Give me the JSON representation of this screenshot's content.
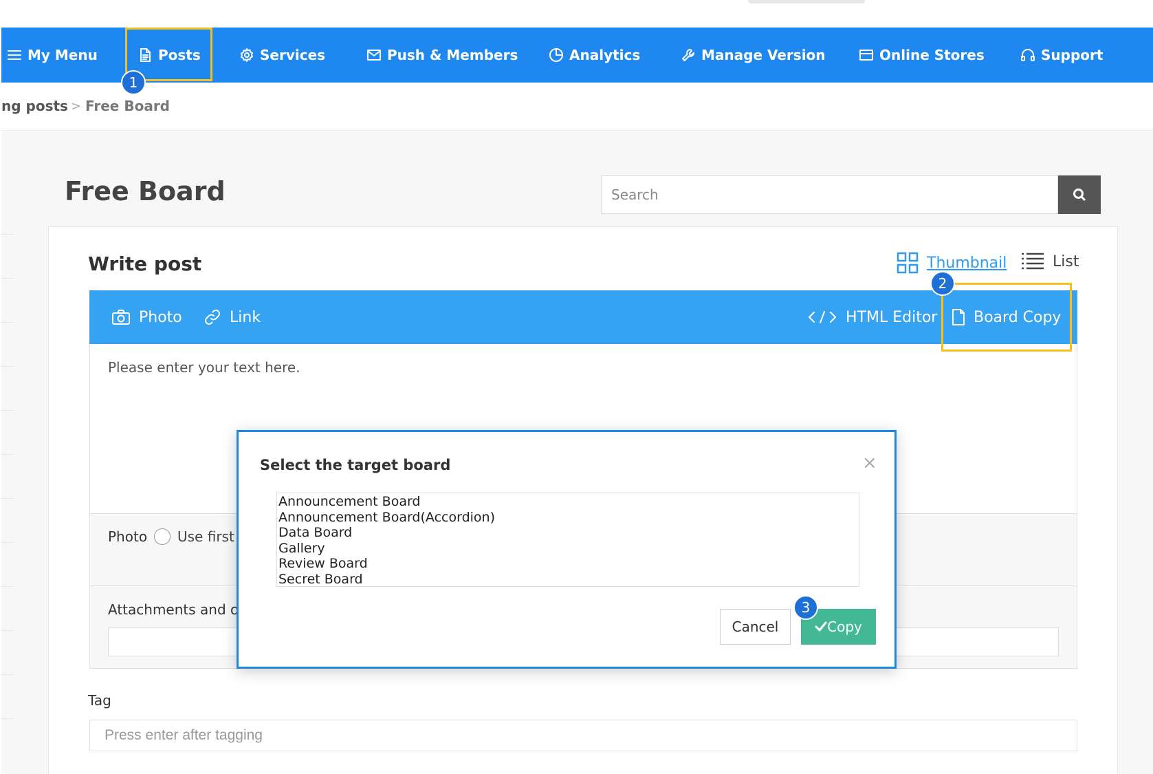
{
  "colors": {
    "nav_bg": "#1e88f0",
    "toolbar_bg": "#36a2f2",
    "highlight": "#f5bf20",
    "step_badge": "#1e6fd6",
    "copy_button": "#42b895",
    "thumbnail_active": "#2f9af0"
  },
  "nav": {
    "items": [
      {
        "label": "My Menu",
        "icon": "menu-icon"
      },
      {
        "label": "Posts",
        "icon": "document-icon"
      },
      {
        "label": "Services",
        "icon": "gear-icon"
      },
      {
        "label": "Push & Members",
        "icon": "mail-icon"
      },
      {
        "label": "Analytics",
        "icon": "pie-chart-icon"
      },
      {
        "label": "Manage Version",
        "icon": "wrench-icon"
      },
      {
        "label": "Online Stores",
        "icon": "card-icon"
      },
      {
        "label": "Support",
        "icon": "headset-icon"
      }
    ]
  },
  "steps": [
    "1",
    "2",
    "3"
  ],
  "breadcrumb": {
    "parent": "ng posts",
    "separator": ">",
    "current": "Free Board"
  },
  "page": {
    "title": "Free Board",
    "search_placeholder": "Search"
  },
  "card": {
    "title": "Write post",
    "view_toggle": {
      "thumbnail": "Thumbnail",
      "list": "List"
    }
  },
  "toolbar": {
    "photo": "Photo",
    "link": "Link",
    "html_editor": "HTML Editor",
    "board_copy": "Board Copy"
  },
  "editor": {
    "placeholder": "Please enter your text here."
  },
  "photo_row": {
    "label": "Photo",
    "option": "Use first"
  },
  "attachments": {
    "label": "Attachments and ot"
  },
  "tag": {
    "label": "Tag",
    "placeholder": "Press enter after tagging"
  },
  "modal": {
    "title": "Select the target board",
    "close": "×",
    "boards": [
      "Announcement Board",
      "Announcement Board(Accordion)",
      "Data Board",
      "Gallery",
      "Review Board",
      "Secret Board"
    ],
    "cancel": "Cancel",
    "copy": "Copy"
  }
}
